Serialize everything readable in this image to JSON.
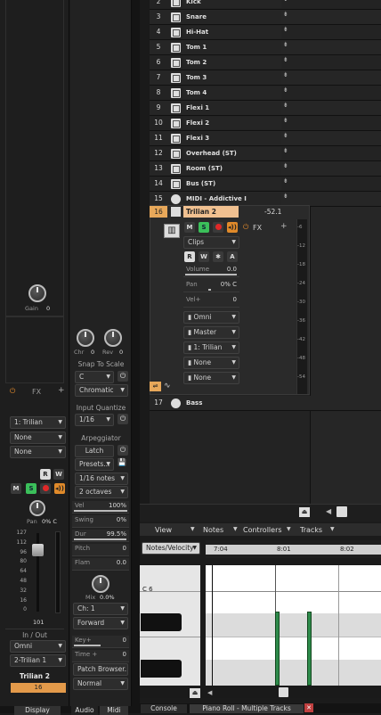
{
  "tracks": [
    {
      "num": "2",
      "name": "Kick"
    },
    {
      "num": "3",
      "name": "Snare"
    },
    {
      "num": "4",
      "name": "Hi-Hat"
    },
    {
      "num": "5",
      "name": "Tom 1"
    },
    {
      "num": "6",
      "name": "Tom 2"
    },
    {
      "num": "7",
      "name": "Tom 3"
    },
    {
      "num": "8",
      "name": "Tom 4"
    },
    {
      "num": "9",
      "name": "Flexi 1"
    },
    {
      "num": "10",
      "name": "Flexi 2"
    },
    {
      "num": "11",
      "name": "Flexi 3"
    },
    {
      "num": "12",
      "name": "Overhead (ST)"
    },
    {
      "num": "13",
      "name": "Room (ST)"
    },
    {
      "num": "14",
      "name": "Bus (ST)"
    },
    {
      "num": "15",
      "name": "MIDI - Addictive I"
    }
  ],
  "selected_track": {
    "num": "16",
    "name": "Trilian 2",
    "level": "-52.1",
    "m": "M",
    "s": "S",
    "fx": "FX",
    "clips": "Clips",
    "r": "R",
    "w": "W",
    "star": "✱",
    "a": "A",
    "volume_label": "Volume",
    "volume_value": "0.0",
    "pan_label": "Pan",
    "pan_value": "0% C",
    "vel_label": "Vel+",
    "vel_value": "0",
    "input": "Omni",
    "output": "Master",
    "channel": "1: Trilian",
    "none1": "None",
    "none2": "None",
    "meter_ticks": [
      "-6",
      "-12",
      "-18",
      "-24",
      "-30",
      "-36",
      "-42",
      "-48",
      "-54"
    ]
  },
  "bass_track": {
    "num": "17",
    "name": "Bass"
  },
  "inspector": {
    "gain_label": "Gain",
    "gain_value": "0",
    "fx_label": "FX",
    "synth": "1: Trilian",
    "none_a": "None",
    "none_b": "None",
    "r": "R",
    "w": "W",
    "m": "M",
    "s": "S",
    "pan_label": "Pan",
    "pan_value": "0% C",
    "fader_ticks": [
      "127",
      "112",
      "96",
      "80",
      "64",
      "48",
      "32",
      "16",
      "0"
    ],
    "fader_value": "101",
    "inout_label": "In / Out",
    "input": "Omni",
    "output": "2-Trilian 1",
    "track_name": "Trilian 2",
    "track_num": "16"
  },
  "midi_panel": {
    "chr_label": "Chr",
    "chr_value": "0",
    "rev_label": "Rev",
    "rev_value": "0",
    "snap_label": "Snap To Scale",
    "snap_key": "C",
    "snap_scale": "Chromatic",
    "quantize_label": "Input Quantize",
    "quantize_value": "1/16",
    "arp_label": "Arpeggiator",
    "latch": "Latch",
    "presets": "Presets...",
    "notes": "1/16 notes",
    "octaves": "2 octaves",
    "vel_label": "Vel",
    "vel_value": "100%",
    "swing_label": "Swing",
    "swing_value": "0%",
    "dur_label": "Dur",
    "dur_value": "99.5%",
    "pitch_label": "Pitch",
    "pitch_value": "0",
    "flam_label": "Flam",
    "flam_value": "0.0",
    "mix_label": "Mix",
    "mix_value": "0.0%",
    "ch": "Ch: 1",
    "direction": "Forward",
    "key_label": "Key+",
    "key_value": "0",
    "time_label": "Time +",
    "time_value": "0",
    "patch_browser": "Patch Browser...",
    "mode": "Normal"
  },
  "bottom_tabs": {
    "display": "Display",
    "audio": "Audio",
    "midi": "Midi",
    "console": "Console",
    "piano_roll": "Piano Roll - Multiple Tracks"
  },
  "piano_roll": {
    "menu": [
      "View",
      "Notes",
      "Controllers",
      "Tracks"
    ],
    "notes_velocity": "Notes/Velocity",
    "ruler": [
      "7:04",
      "8:01",
      "8:02"
    ],
    "c6": "C 6"
  }
}
